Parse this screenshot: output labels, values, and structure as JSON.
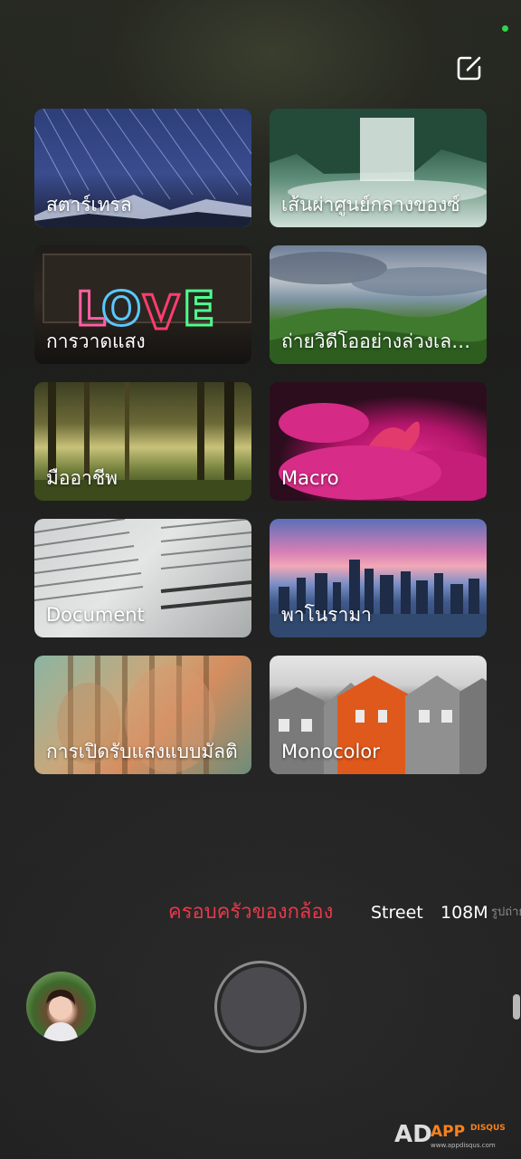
{
  "status": {
    "indicator_color": "#2fd34f"
  },
  "toolbar": {
    "edit_icon": "edit-icon"
  },
  "modes": [
    {
      "label": "สตาร์เทรล",
      "art": "art-startrail"
    },
    {
      "label": "เส้นผ่าศูนย์กลางของซ์",
      "art": "art-waterfall"
    },
    {
      "label": "การวาดแสง",
      "art": "art-love"
    },
    {
      "label": "ถ่ายวิดีโออย่างล่วงเลย...",
      "art": "art-hills"
    },
    {
      "label": "มืออาชีพ",
      "art": "art-forest"
    },
    {
      "label": "Macro",
      "art": "art-macro"
    },
    {
      "label": "Document",
      "art": "art-document"
    },
    {
      "label": "พาโนรามา",
      "art": "art-panorama"
    },
    {
      "label": "การเปิดรับแสงแบบมัลติ",
      "art": "art-multi"
    },
    {
      "label": "Monocolor",
      "art": "art-mono"
    }
  ],
  "mode_bar": {
    "active": "ครอบครัวของกล้อง",
    "street": "Street",
    "m108": "108M",
    "portrait": "รูปถ่าย",
    "active_color": "#e6394a"
  },
  "controls": {
    "gallery_thumb_icon": "gallery-thumbnail",
    "shutter_icon": "shutter-button"
  },
  "watermark": {
    "brand": "APP",
    "suffix": "DISQUS",
    "url": "www.appdisqus.com"
  }
}
